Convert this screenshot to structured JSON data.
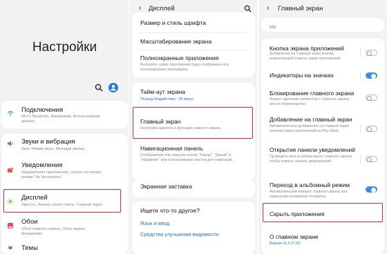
{
  "panel1": {
    "title": "Настройки",
    "items": [
      {
        "label": "Подключения",
        "sub": "Wi-Fi, Bluetooth, Авиарежим, Использование данных",
        "icon": "wifi-icon",
        "color": "#3aa0e8"
      },
      {
        "label": "Звуки и вибрация",
        "sub": "Звук, Режим звука, Мелодия звонка",
        "icon": "volume-icon",
        "color": "#7b5fe0"
      },
      {
        "label": "Уведомления",
        "sub": "Уведомления приложений, строка состояния, режим \"Не беспокоить\"",
        "icon": "notification-icon",
        "color": "#e05a3a"
      },
      {
        "label": "Дисплей",
        "sub": "Яркость, Фильтр синего света, Главный экран",
        "icon": "display-icon",
        "color": "#8cc63f"
      },
      {
        "label": "Обои",
        "sub": "Обои главного экрана, Обои экрана блокировки",
        "icon": "wallpaper-icon",
        "color": "#e0457b"
      },
      {
        "label": "Темы",
        "sub": "",
        "icon": "themes-icon",
        "color": "#8a63d2"
      }
    ]
  },
  "panel2": {
    "title": "Дисплей",
    "rows": [
      {
        "label": "Размер и стиль шрифта",
        "sub": ""
      },
      {
        "label": "Масштабирование экрана",
        "sub": ""
      },
      {
        "label": "Полноэкранные приложения",
        "sub": "Выберите, какие приложения будут отображаться в полноэкранных пропорциях."
      },
      {
        "label": "Тайм-аут экрана",
        "sub": "Период бездействия - 30 минут"
      },
      {
        "label": "Главный экран",
        "sub": "Настройка макетов и функций главного экрана."
      },
      {
        "label": "Навигационная панель",
        "sub": "Отображение или скрытие кнопок \"Назад\", \"Домой\" и \"Недавние\" или использование жестов для навигации."
      },
      {
        "label": "Экранная заставка",
        "sub": ""
      }
    ],
    "suggest": {
      "title": "Ищете что-то другое?",
      "links": [
        "Язык и ввод",
        "Средства улучшения видимости"
      ]
    }
  },
  "panel3": {
    "title": "Главный экран",
    "top_fragment": "5X6",
    "rows": [
      {
        "label": "Кнопка экрана приложений",
        "sub": "Добавление на главный экран кнопки, позволяющей открыть экран приложений.",
        "toggle": false
      },
      {
        "label": "Индикаторы на значках",
        "sub": "",
        "toggle": true
      },
      {
        "label": "Блокирование главного экрана",
        "sub": "Запрет удаления элементов с главного экрана или их перемещения.",
        "toggle": false
      },
      {
        "label": "Добавление на главный экран",
        "sub": "Автоматическое добавление на главный экран значков новых приложений из Play Store.",
        "toggle": false
      },
      {
        "label": "Открытие панели уведомлений",
        "sub": "Проведите вниз в любом месте главного экрана, чтобы открыть панель уведомлений.",
        "toggle": false
      },
      {
        "label": "Переход в альбомный режим",
        "sub": "Автоматический поворот главного экрана при изменении положения телефона.",
        "toggle": true
      },
      {
        "label": "Скрыть приложения",
        "sub": ""
      },
      {
        "label": "О главном экране",
        "sub": "Версия 11.5.07.43"
      }
    ]
  }
}
